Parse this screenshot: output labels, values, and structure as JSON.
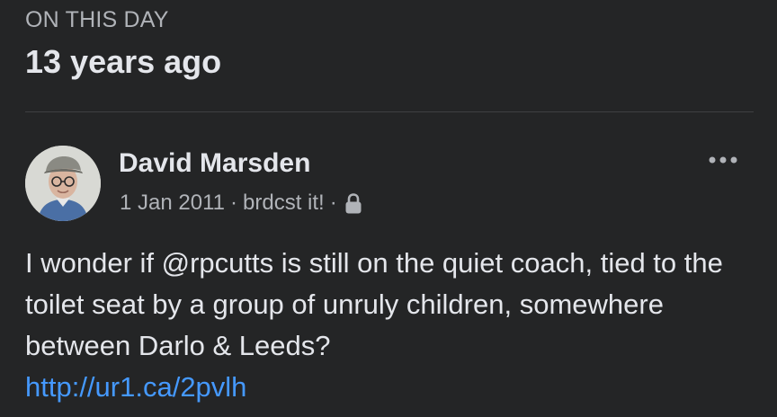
{
  "memory": {
    "eyebrow": "ON THIS DAY",
    "years_ago": "13 years ago"
  },
  "post": {
    "author": "David Marsden",
    "date": "1 Jan 2011",
    "separator": "·",
    "source": "brdcst it!",
    "privacy_icon": "lock-icon",
    "menu_icon": "more-options-icon",
    "text": "I wonder if @rpcutts is still on the quiet coach, tied to the toilet seat by a group of unruly children, somewhere between Darlo & Leeds?",
    "link": "http://ur1.ca/2pvlh"
  },
  "colors": {
    "background": "#242526",
    "primary_text": "#e4e6eb",
    "secondary_text": "#b0b3b8",
    "link": "#4599ff",
    "divider": "#3e4042"
  }
}
